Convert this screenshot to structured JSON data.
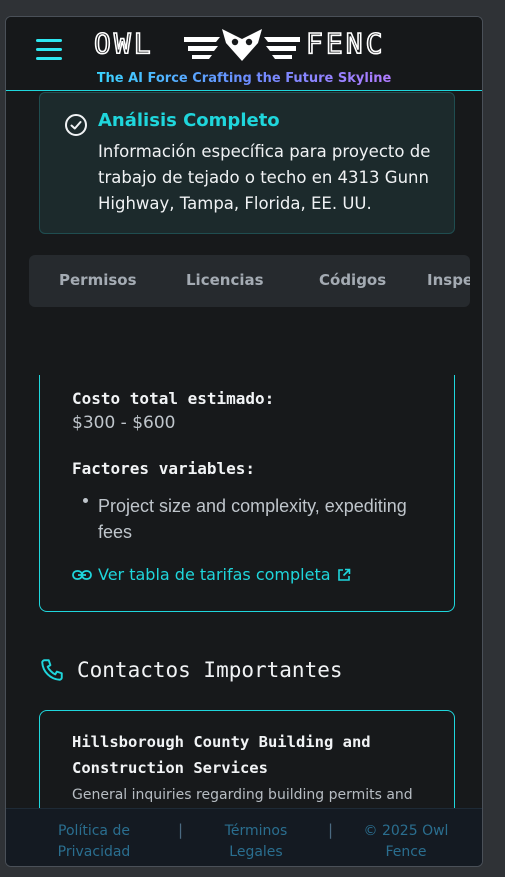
{
  "header": {
    "logo_text_left": "OWL",
    "logo_text_right": "FENC",
    "tagline": "The AI Force Crafting the Future Skyline"
  },
  "analysis": {
    "title": "Análisis Completo",
    "description": "Información específica para proyecto de trabajo de tejado o techo en 4313 Gunn Highway, Tampa, Florida, EE. UU."
  },
  "tabs": [
    {
      "label": "Permisos"
    },
    {
      "label": "Licencias"
    },
    {
      "label": "Códigos"
    },
    {
      "label": "Inspecciones"
    }
  ],
  "cost": {
    "label": "Costo total estimado:",
    "value": "$300 - $600",
    "factors_label": "Factores variables:",
    "factors": [
      "Project size and complexity, expediting fees"
    ],
    "link_label": "Ver tabla de tarifas completa"
  },
  "contacts": {
    "heading": "Contactos Importantes",
    "items": [
      {
        "name": "Hillsborough County Building and Construction Services",
        "description": "General inquiries regarding building permits and"
      }
    ]
  },
  "footer": {
    "privacy": "Política de Privacidad",
    "terms": "Términos Legales",
    "copyright": "© 2025 Owl Fence"
  },
  "colors": {
    "accent": "#1fd6dc",
    "background": "#17191b"
  }
}
